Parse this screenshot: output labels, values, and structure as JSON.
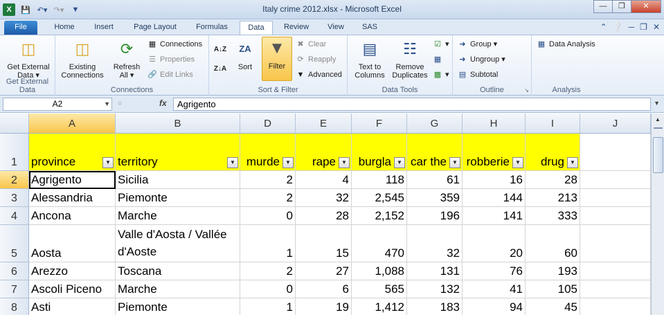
{
  "window": {
    "title": "Italy crime 2012.xlsx - Microsoft Excel",
    "app_icon": "X"
  },
  "ribbon_tabs": [
    "File",
    "Home",
    "Insert",
    "Page Layout",
    "Formulas",
    "Data",
    "Review",
    "View",
    "SAS"
  ],
  "active_tab": "Data",
  "ribbon": {
    "get_external": {
      "btn1": "Get External",
      "btn1b": "Data",
      "group": "Get External Data"
    },
    "connections": {
      "existing": "Existing",
      "existing_b": "Connections",
      "refresh": "Refresh",
      "refresh_b": "All",
      "connections": "Connections",
      "properties": "Properties",
      "edit_links": "Edit Links",
      "group": "Connections"
    },
    "sort_filter": {
      "sort": "Sort",
      "filter": "Filter",
      "clear": "Clear",
      "reapply": "Reapply",
      "advanced": "Advanced",
      "group": "Sort & Filter"
    },
    "data_tools": {
      "text_to": "Text to",
      "columns": "Columns",
      "remove": "Remove",
      "duplicates": "Duplicates",
      "group": "Data Tools"
    },
    "outline": {
      "group_btn": "Group",
      "ungroup": "Ungroup",
      "subtotal": "Subtotal",
      "group": "Outline"
    },
    "analysis": {
      "data_analysis": "Data Analysis",
      "group": "Analysis"
    }
  },
  "formula_bar": {
    "name_box": "A2",
    "fx": "fx",
    "value": "Agrigento"
  },
  "columns": [
    "A",
    "B",
    "D",
    "E",
    "F",
    "G",
    "H",
    "I",
    "J"
  ],
  "headers": [
    "province",
    "territory",
    "murde",
    "rape",
    "burgla",
    "car the",
    "robberie",
    "drug"
  ],
  "rows": [
    {
      "num": "1"
    },
    {
      "num": "2",
      "cells": [
        "Agrigento",
        "Sicilia",
        "2",
        "4",
        "118",
        "61",
        "16",
        "28"
      ]
    },
    {
      "num": "3",
      "cells": [
        "Alessandria",
        "Piemonte",
        "2",
        "32",
        "2,545",
        "359",
        "144",
        "213"
      ]
    },
    {
      "num": "4",
      "cells": [
        "Ancona",
        "Marche",
        "0",
        "28",
        "2,152",
        "196",
        "141",
        "333"
      ]
    },
    {
      "num": "5",
      "cells": [
        "Aosta",
        "Valle d'Aosta / Vallée d'Aoste",
        "1",
        "15",
        "470",
        "32",
        "20",
        "60"
      ]
    },
    {
      "num": "6",
      "cells": [
        "Arezzo",
        "Toscana",
        "2",
        "27",
        "1,088",
        "131",
        "76",
        "193"
      ]
    },
    {
      "num": "7",
      "cells": [
        "Ascoli Piceno",
        "Marche",
        "0",
        "6",
        "565",
        "132",
        "41",
        "105"
      ]
    },
    {
      "num": "8",
      "cells": [
        "Asti",
        "Piemonte",
        "1",
        "19",
        "1,412",
        "183",
        "94",
        "45"
      ]
    }
  ]
}
